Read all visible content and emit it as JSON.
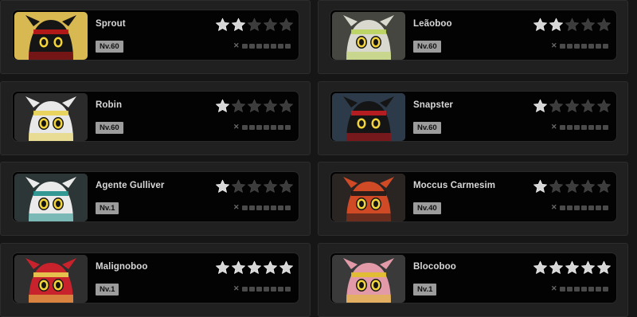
{
  "colors": {
    "star_filled": "#d6d6d6",
    "star_empty": "#3c3c3c",
    "card_bg": "#030303",
    "panel_bg": "#202020",
    "level_badge": "#9c9c9c"
  },
  "characters": [
    {
      "name": "Sprout",
      "level": "Nv.60",
      "stars": 2,
      "max_stars": 5,
      "portrait_bg": "#d8b850",
      "body": "#151515",
      "accent": "#c21818",
      "column": "left",
      "row": 0
    },
    {
      "name": "Leãoboo",
      "level": "Nv.60",
      "stars": 2,
      "max_stars": 5,
      "portrait_bg": "#44463f",
      "body": "#d9d9cf",
      "accent": "#b9d35a",
      "column": "right",
      "row": 0
    },
    {
      "name": "Robin",
      "level": "Nv.60",
      "stars": 1,
      "max_stars": 5,
      "portrait_bg": "#2b2b2b",
      "body": "#e8e8e8",
      "accent": "#e8d250",
      "column": "left",
      "row": 1
    },
    {
      "name": "Snapster",
      "level": "Nv.60",
      "stars": 1,
      "max_stars": 5,
      "portrait_bg": "#2c3a4a",
      "body": "#151515",
      "accent": "#c41d22",
      "column": "right",
      "row": 1
    },
    {
      "name": "Agente Gulliver",
      "level": "Nv.1",
      "stars": 1,
      "max_stars": 5,
      "portrait_bg": "#2d3636",
      "body": "#eaeaea",
      "accent": "#1f8f8a",
      "column": "left",
      "row": 2
    },
    {
      "name": "Moccus Carmesim",
      "level": "Nv.40",
      "stars": 1,
      "max_stars": 5,
      "portrait_bg": "#2a2422",
      "body": "#d04a26",
      "accent": "#181818",
      "column": "right",
      "row": 2
    },
    {
      "name": "Malignoboo",
      "level": "Nv.1",
      "stars": 5,
      "max_stars": 5,
      "portrait_bg": "#2f2f2f",
      "body": "#c8222c",
      "accent": "#e8d250",
      "column": "left",
      "row": 3
    },
    {
      "name": "Blocoboo",
      "level": "Nv.1",
      "stars": 5,
      "max_stars": 5,
      "portrait_bg": "#3a3a3a",
      "body": "#e39aa8",
      "accent": "#e0c028",
      "column": "right",
      "row": 3
    }
  ],
  "icons": {
    "star": "star-icon",
    "progress_marker": "x-marker-icon"
  },
  "progress_marker_glyph": "✕"
}
